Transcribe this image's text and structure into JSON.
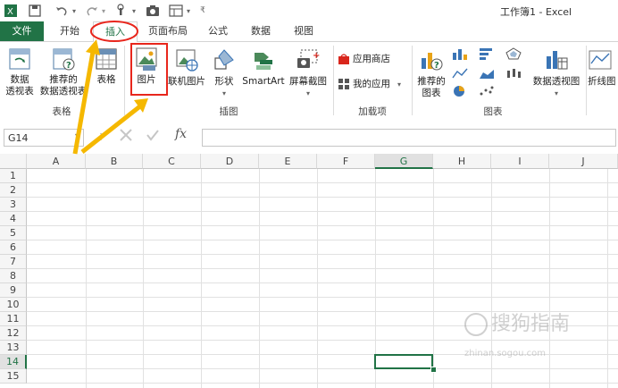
{
  "window": {
    "title": "工作簿1 - Excel"
  },
  "quick_access": [
    "save-icon",
    "undo-icon",
    "redo-icon",
    "touch-mode-icon",
    "camera-icon",
    "form-icon",
    "customize-icon"
  ],
  "tabs": [
    {
      "id": "file",
      "label": "文件"
    },
    {
      "id": "home",
      "label": "开始"
    },
    {
      "id": "insert",
      "label": "插入"
    },
    {
      "id": "page_layout",
      "label": "页面布局"
    },
    {
      "id": "formulas",
      "label": "公式"
    },
    {
      "id": "data",
      "label": "数据"
    },
    {
      "id": "view",
      "label": "视图"
    }
  ],
  "ribbon": {
    "tables": {
      "label": "表格",
      "pivot_line1": "数据",
      "pivot_line2": "透视表",
      "recommended_line1": "推荐的",
      "recommended_line2": "数据透视表",
      "table": "表格"
    },
    "illustrations": {
      "label": "插图",
      "picture": "图片",
      "online_picture": "联机图片",
      "shapes": "形状",
      "smartart": "SmartArt",
      "screenshot": "屏幕截图"
    },
    "addins": {
      "label": "加载项",
      "store": "应用商店",
      "my_apps": "我的应用"
    },
    "charts": {
      "label": "图表",
      "recommended_line1": "推荐的",
      "recommended_line2": "图表",
      "pivot_chart": "数据透视图",
      "line_partial": "折线图"
    }
  },
  "formula_bar": {
    "name_box": "G14",
    "fx": "fx",
    "value": ""
  },
  "sheet": {
    "columns": [
      "A",
      "B",
      "C",
      "D",
      "E",
      "F",
      "G",
      "H",
      "I",
      "J"
    ],
    "rows": [
      "1",
      "2",
      "3",
      "4",
      "5",
      "6",
      "7",
      "8",
      "9",
      "10",
      "11",
      "12",
      "13",
      "14",
      "15"
    ],
    "selected_cell": "G14"
  },
  "watermark": {
    "text": "搜狗指南",
    "sub": "zhinan.sogou.com"
  },
  "colors": {
    "excel_green": "#217346",
    "annotation_red": "#e8261c",
    "annotation_arrow": "#f5b800"
  }
}
